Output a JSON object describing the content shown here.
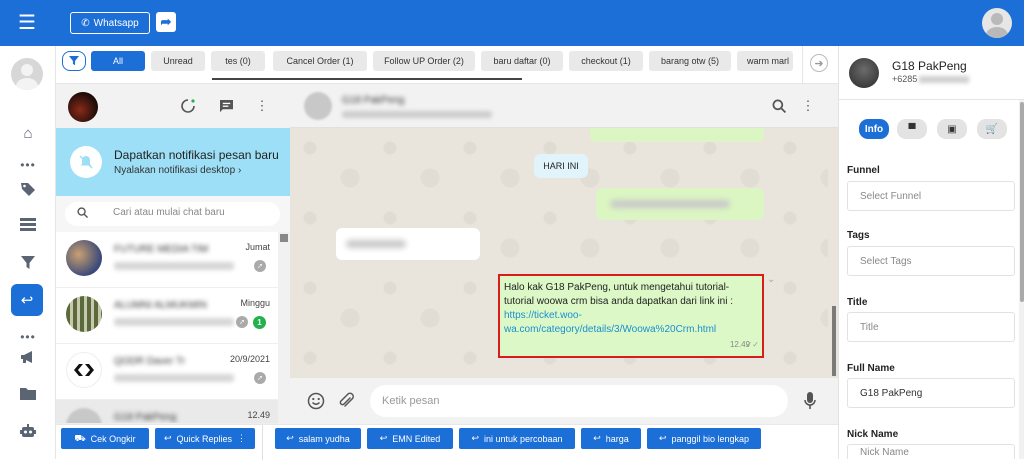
{
  "topbar": {
    "whatsapp_label": "Whatsapp"
  },
  "filters": {
    "chips": [
      {
        "label": "All",
        "active": true
      },
      {
        "label": "Unread"
      },
      {
        "label": "tes (0)"
      },
      {
        "label": "Cancel Order (1)"
      },
      {
        "label": "Follow UP Order (2)"
      },
      {
        "label": "baru daftar (0)"
      },
      {
        "label": "checkout (1)"
      },
      {
        "label": "barang otw (5)"
      },
      {
        "label": "warm marl"
      }
    ]
  },
  "chatlist": {
    "notification": {
      "title": "Dapatkan notifikasi pesan baru",
      "subtitle": "Nyalakan notifikasi desktop ›"
    },
    "search_placeholder": "Cari atau mulai chat baru",
    "items": [
      {
        "name": "FUTURE MEDIA TIM",
        "time": "Jumat"
      },
      {
        "name": "ALUMNI ALMUKMIN",
        "time": "Minggu",
        "badge": "1"
      },
      {
        "name": "QODR Daver Tr",
        "time": "20/9/2021"
      },
      {
        "name": "G18 PakPeng",
        "time": "12.49"
      }
    ]
  },
  "conversation": {
    "header_name": "G18 PakPeng",
    "day_label": "HARI INI",
    "message": {
      "text": "Halo kak G18 PakPeng, untuk mengetahui tutorial-tutorial woowa crm bisa anda dapatkan dari link ini :",
      "link": "https://ticket.woo-wa.com/category/details/3/Woowa%20Crm.html",
      "time": "12.49"
    },
    "composer_placeholder": "Ketik pesan"
  },
  "bottombar": {
    "cek_ongkir": "Cek Ongkir",
    "quick_replies": "Quick Replies",
    "replies": [
      "salam yudha",
      "EMN Edited",
      "ini untuk percobaan",
      "harga",
      "panggil bio lengkap"
    ]
  },
  "contact": {
    "name": "G18 PakPeng",
    "phone_prefix": "+6285",
    "tabs": {
      "info": "Info"
    },
    "fields": {
      "funnel_label": "Funnel",
      "funnel_placeholder": "Select Funnel",
      "tags_label": "Tags",
      "tags_placeholder": "Select Tags",
      "title_label": "Title",
      "title_placeholder": "Title",
      "fullname_label": "Full Name",
      "fullname_value": "G18 PakPeng",
      "nickname_label": "Nick Name",
      "nickname_placeholder": "Nick Name"
    }
  },
  "colors": {
    "primary": "#1d6fd8",
    "notification": "#9ddff6",
    "outgoing": "#dcf8c6",
    "highlight": "#d81b1b"
  }
}
